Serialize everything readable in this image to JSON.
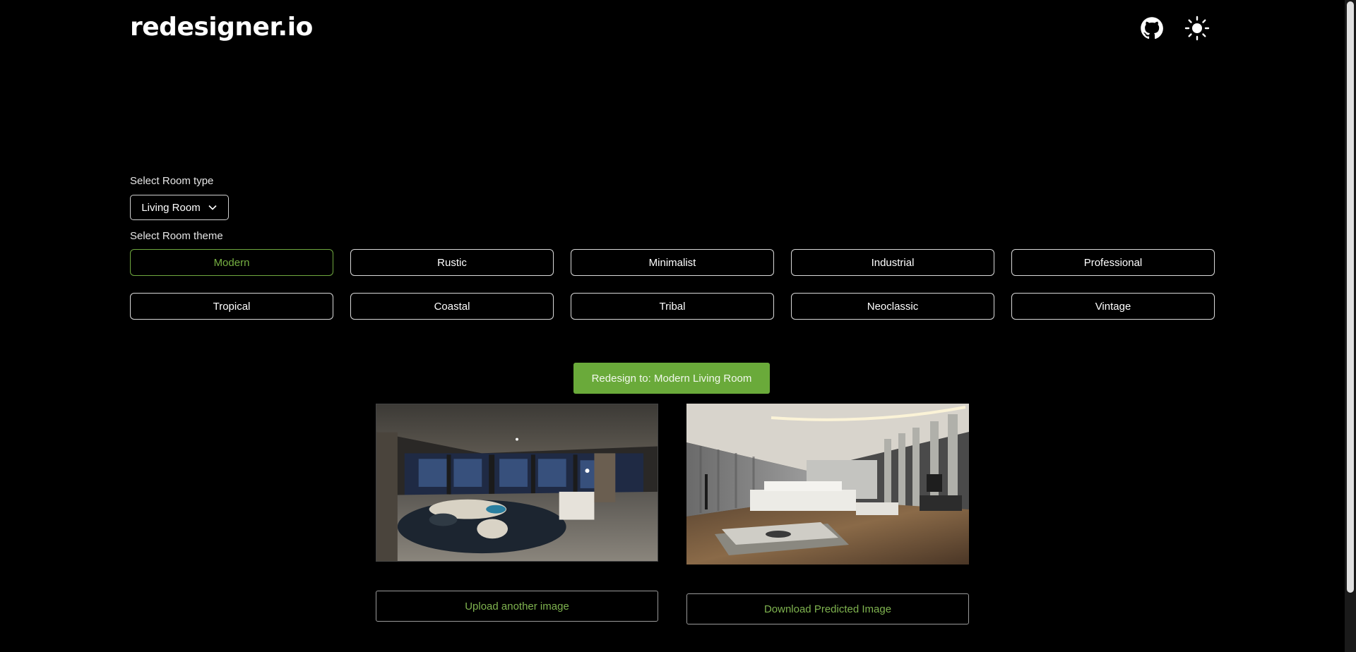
{
  "header": {
    "logo": "redesigner.io",
    "github_icon": "github-icon",
    "theme_toggle_icon": "sun-icon"
  },
  "room_type": {
    "label": "Select Room type",
    "selected": "Living Room"
  },
  "room_theme": {
    "label": "Select Room theme",
    "options": [
      "Modern",
      "Rustic",
      "Minimalist",
      "Industrial",
      "Professional",
      "Tropical",
      "Coastal",
      "Tribal",
      "Neoclassic",
      "Vintage"
    ],
    "selected": "Modern"
  },
  "actions": {
    "redesign_label": "Redesign to: Modern Living Room",
    "upload_label": "Upload another image",
    "download_label": "Download Predicted Image"
  },
  "colors": {
    "accent": "#6aaa3a",
    "background": "#000000"
  }
}
